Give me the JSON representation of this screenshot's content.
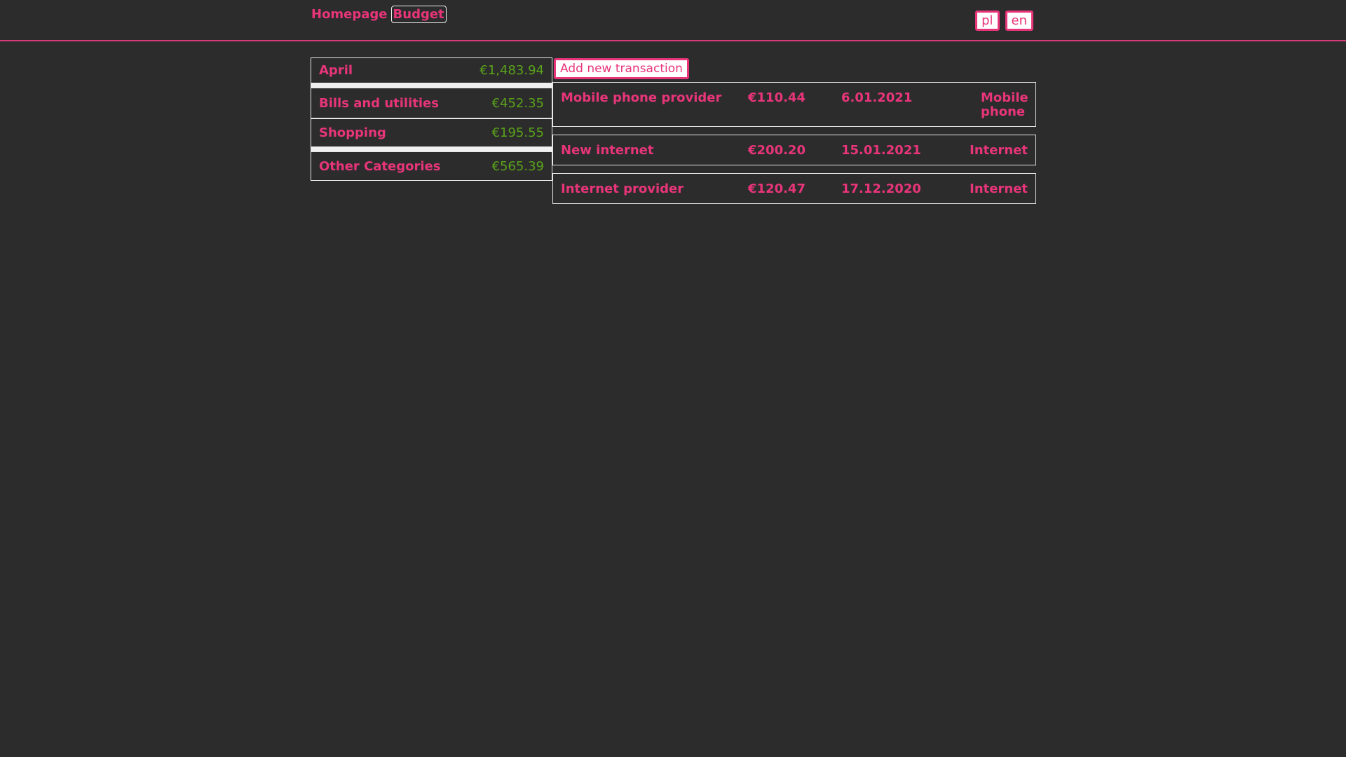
{
  "nav": {
    "homepage": "Homepage",
    "budget": "Budget"
  },
  "languages": [
    "pl",
    "en"
  ],
  "categories": [
    {
      "name": "April",
      "amount": "€1,483.94"
    },
    {
      "name": "Bills and utilities",
      "amount": "€452.35"
    },
    {
      "name": "Shopping",
      "amount": "€195.55"
    },
    {
      "name": "Other Categories",
      "amount": "€565.39"
    }
  ],
  "add_button": "Add new transaction",
  "transactions": [
    {
      "name": "Mobile phone provider",
      "amount": "€110.44",
      "date": "6.01.2021",
      "category": "Mobile phone"
    },
    {
      "name": "New internet",
      "amount": "€200.20",
      "date": "15.01.2021",
      "category": "Internet"
    },
    {
      "name": "Internet provider",
      "amount": "€120.47",
      "date": "17.12.2020",
      "category": "Internet"
    }
  ],
  "colors": {
    "background": "#2c2c2c",
    "accent": "#e8357a",
    "amount_green": "#5aa31a",
    "border": "#e6e6e6"
  }
}
